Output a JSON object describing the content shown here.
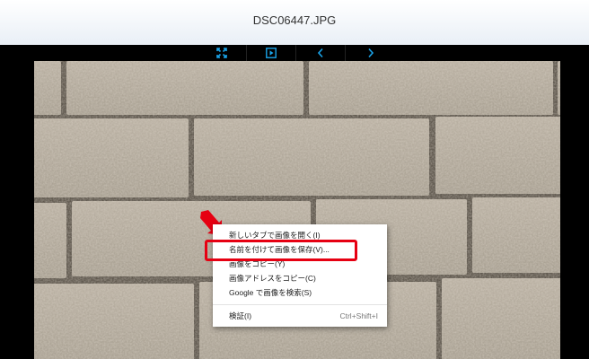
{
  "window": {
    "title": "DSC06447.JPG"
  },
  "toolbar": {
    "buttons": [
      {
        "name": "fullscreen-button",
        "icon": "fullscreen-icon"
      },
      {
        "name": "slideshow-button",
        "icon": "play-icon"
      },
      {
        "name": "previous-button",
        "icon": "chevron-left-icon"
      },
      {
        "name": "next-button",
        "icon": "chevron-right-icon"
      }
    ],
    "icon_color": "#1aa3e8"
  },
  "context_menu": {
    "items": [
      {
        "label": "新しいタブで画像を開く(I)",
        "shortcut": ""
      },
      {
        "label": "名前を付けて画像を保存(V)...",
        "shortcut": ""
      },
      {
        "label": "画像をコピー(Y)",
        "shortcut": ""
      },
      {
        "label": "画像アドレスをコピー(C)",
        "shortcut": ""
      },
      {
        "label": "Google で画像を検索(S)",
        "shortcut": ""
      },
      {
        "label": "検証(I)",
        "shortcut": "Ctrl+Shift+I"
      }
    ]
  },
  "annotation": {
    "highlight_color": "#e60012"
  }
}
